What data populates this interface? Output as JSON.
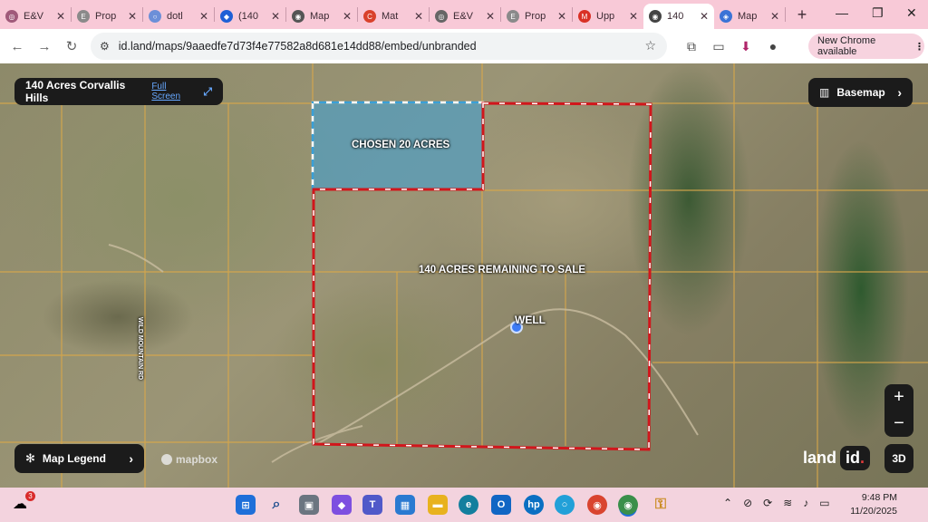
{
  "browser": {
    "tabs": [
      {
        "label": "E&V",
        "color": "#a05a7a",
        "glyph": "◎"
      },
      {
        "label": "Prop",
        "color": "#8a8a8a",
        "glyph": "E"
      },
      {
        "label": "dotl",
        "color": "#6c8fd8",
        "glyph": "○"
      },
      {
        "label": "(140",
        "color": "#1f5fd6",
        "glyph": "◆"
      },
      {
        "label": "Map",
        "color": "#555555",
        "glyph": "◉"
      },
      {
        "label": "Mat",
        "color": "#d9412b",
        "glyph": "C"
      },
      {
        "label": "E&V",
        "color": "#666666",
        "glyph": "◎"
      },
      {
        "label": "Prop",
        "color": "#8a8a8a",
        "glyph": "E"
      },
      {
        "label": "Upp",
        "color": "#d93025",
        "glyph": "M"
      },
      {
        "label": "140",
        "color": "#444444",
        "glyph": "◉",
        "active": true
      },
      {
        "label": "Map",
        "color": "#3b73d6",
        "glyph": "◈"
      }
    ],
    "url": "id.land/maps/9aaedfe7d73f4e77582a8d681e14dd88/embed/unbranded",
    "new_chrome_label": "New Chrome available"
  },
  "map": {
    "title": "140 Acres Corvallis Hills",
    "full_screen_label": "Full Screen",
    "basemap_label": "Basemap",
    "legend_label": "Map Legend",
    "btn_3d": "3D",
    "zoom_in": "+",
    "zoom_out": "−",
    "attribution": "mapbox",
    "brand_land": "land",
    "brand_id": "id",
    "labels": {
      "chosen": "CHOSEN 20 ACRES",
      "remaining": "140 ACRES REMAINING TO SALE",
      "well": "WELL",
      "road": "WILD MOUNTAIN RD"
    },
    "colors": {
      "boundary": "#d1161c",
      "chosen_fill": "#3aa0d8",
      "parcel_lines": "#d9a84a"
    }
  },
  "taskbar": {
    "weather_badge": "3",
    "time": "9:48 PM",
    "date": "11/20/2025"
  }
}
